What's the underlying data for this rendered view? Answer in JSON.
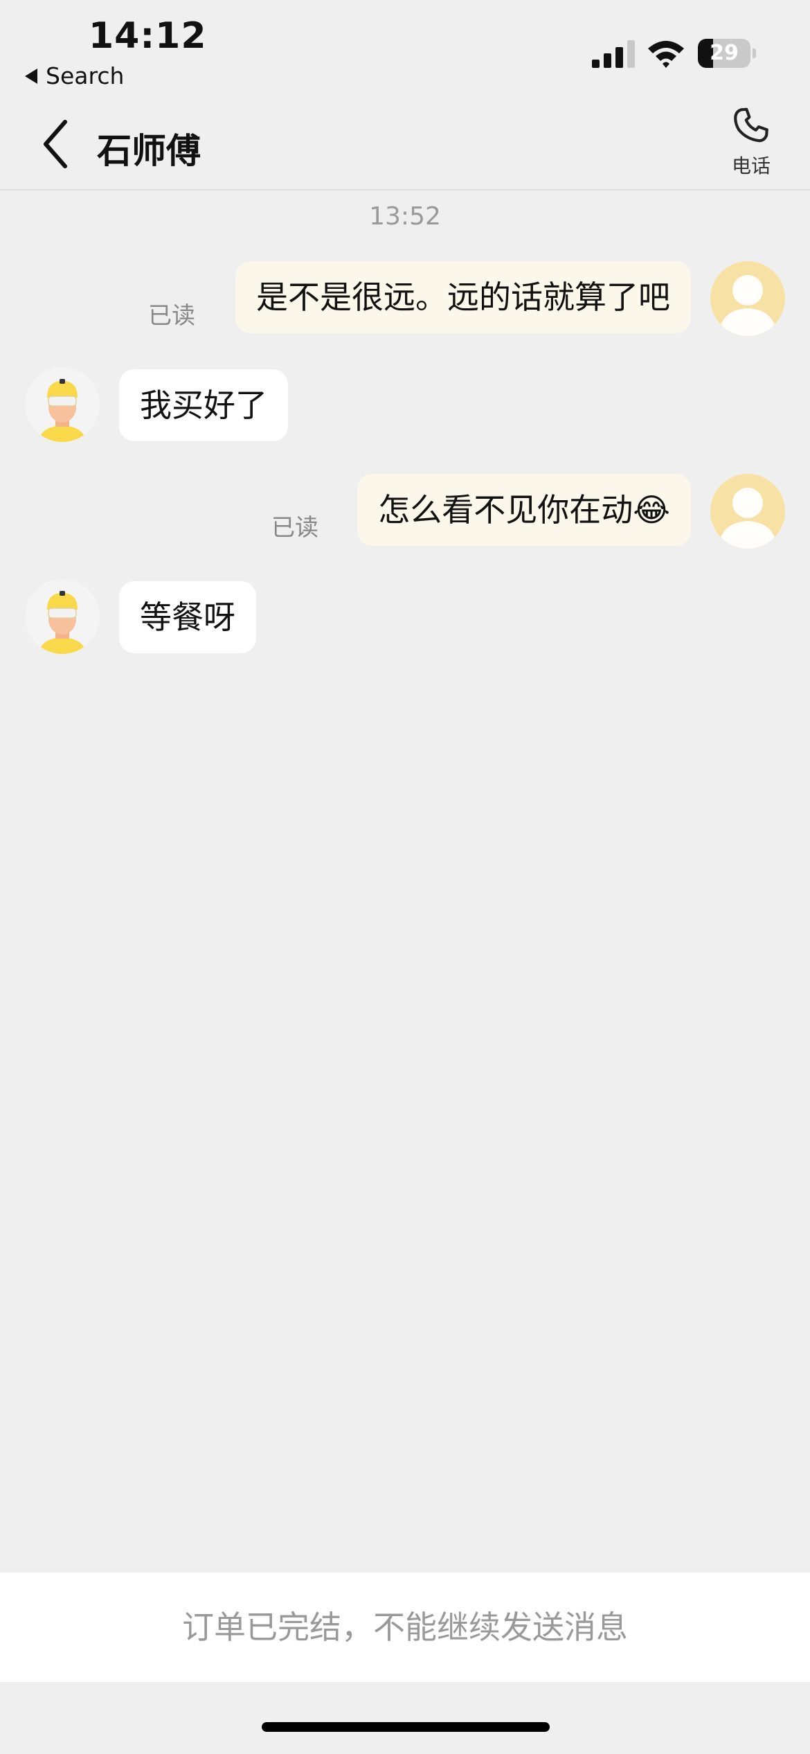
{
  "status_bar": {
    "time": "14:12",
    "back_app": "Search",
    "battery_level": "29",
    "battery_fraction": 0.29,
    "signal_bars_active": 3,
    "signal_bars_total": 4
  },
  "nav": {
    "title": "石师傅",
    "phone_label": "电话"
  },
  "chat": {
    "timestamp": "13:52",
    "messages": [
      {
        "from": "me",
        "text": "是不是很远。远的话就算了吧",
        "status": "已读"
      },
      {
        "from": "rider",
        "text": "我买好了"
      },
      {
        "from": "me",
        "text": "怎么看不见你在动😂",
        "status": "已读"
      },
      {
        "from": "rider",
        "text": "等餐呀"
      }
    ]
  },
  "footer": {
    "notice": "订单已完结，不能继续发送消息"
  },
  "colors": {
    "background": "#efefef",
    "my_bubble": "#fbf7ea",
    "rider_bubble": "#ffffff",
    "my_avatar": "#f8e1a4",
    "rider_helmet": "#f9d84a"
  }
}
